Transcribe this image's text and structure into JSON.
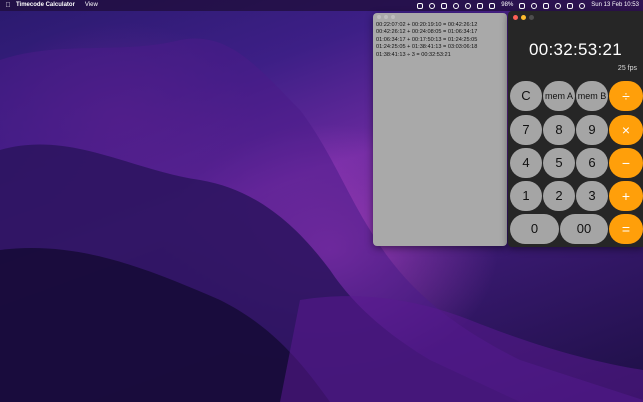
{
  "menubar": {
    "app_name": "Timecode Calculator",
    "menu_view": "View",
    "battery": "98%",
    "datetime": "Sun 13 Feb  10:53"
  },
  "history": {
    "lines": [
      "00:22:07:02 + 00:20:19:10 = 00:42:26:12",
      "00:42:26:12 + 00:24:08:05 = 01:06:34:17",
      "01:06:34:17 + 00:17:50:13 = 01:24:25:05",
      "01:24:25:05 + 01:38:41:13 = 03:03:06:18",
      "01:38:41:13 ÷ 3 = 00:32:53:21"
    ]
  },
  "calculator": {
    "display": "00:32:53:21",
    "frame_rate": "25 fps",
    "colors": {
      "orange": "#ff9f0a",
      "dark": "#505050",
      "light": "#a5a5a5"
    },
    "buttons": {
      "clear": "C",
      "mem_a": "mem A",
      "mem_b": "mem B",
      "divide": "÷",
      "seven": "7",
      "eight": "8",
      "nine": "9",
      "multiply": "×",
      "four": "4",
      "five": "5",
      "six": "6",
      "minus": "−",
      "one": "1",
      "two": "2",
      "three": "3",
      "plus": "+",
      "zero": "0",
      "double_zero": "00",
      "equals": "="
    }
  }
}
